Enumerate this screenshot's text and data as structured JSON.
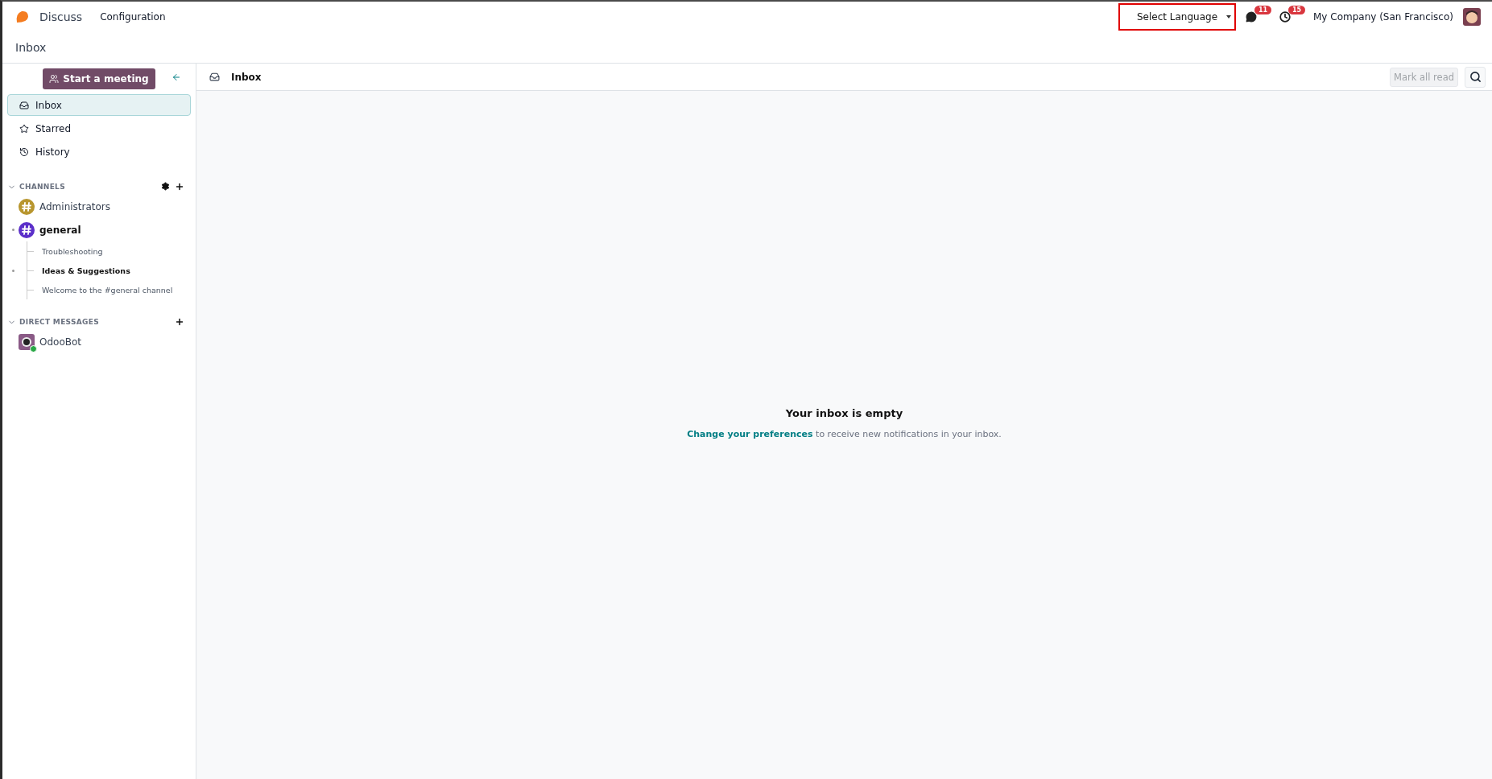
{
  "navbar": {
    "app": "Discuss",
    "menus": [
      "Configuration"
    ],
    "language_select": {
      "value": "Select Language"
    },
    "messages_badge": "11",
    "activities_badge": "15",
    "company": "My Company (San Francisco)"
  },
  "breadcrumb": "Inbox",
  "sidebar": {
    "meeting_button": "Start a meeting",
    "mailboxes": [
      {
        "label": "Inbox",
        "selected": true
      },
      {
        "label": "Starred",
        "selected": false
      },
      {
        "label": "History",
        "selected": false
      }
    ],
    "channels": {
      "title": "CHANNELS",
      "expanded": true,
      "items": [
        {
          "name": "Administrators",
          "color": "#b8962e",
          "unread": false
        },
        {
          "name": "general",
          "color": "#5b2fc9",
          "unread": true,
          "children": [
            {
              "name": "Troubleshooting",
              "unread": false
            },
            {
              "name": "Ideas & Suggestions",
              "unread": true
            },
            {
              "name": "Welcome to the #general channel",
              "unread": false
            }
          ]
        }
      ]
    },
    "direct_messages": {
      "title": "DIRECT MESSAGES",
      "expanded": true,
      "items": [
        {
          "name": "OdooBot",
          "online": true
        }
      ]
    }
  },
  "toolbar": {
    "title": "Inbox",
    "mark_all_read": {
      "label": "Mark all read",
      "disabled": true
    }
  },
  "empty_state": {
    "title": "Your inbox is empty",
    "link": "Change your preferences",
    "text": " to receive new notifications in your inbox."
  }
}
